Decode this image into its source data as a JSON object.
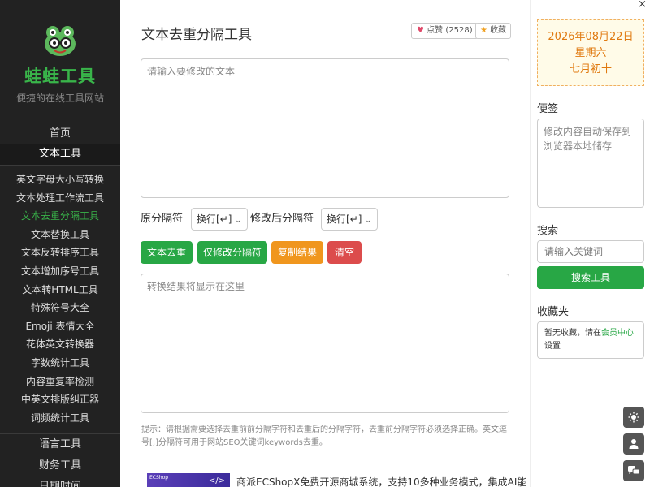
{
  "sidebar": {
    "title": "蛙蛙工具",
    "subtitle": "便捷的在线工具网站",
    "home": "首页",
    "active_category": "文本工具",
    "sub_items": [
      "英文字母大小写转换",
      "文本处理工作流工具",
      "文本去重分隔工具",
      "文本替换工具",
      "文本反转排序工具",
      "文本增加序号工具",
      "文本转HTML工具",
      "特殊符号大全",
      "Emoji 表情大全",
      "花体英文转换器",
      "字数统计工具",
      "内容重复率检测",
      "中英文排版纠正器",
      "词频统计工具"
    ],
    "active_sub_index": 2,
    "categories": [
      "语言工具",
      "财务工具",
      "日期时间"
    ]
  },
  "main": {
    "title": "文本去重分隔工具",
    "like_label": "点赞",
    "like_count": "(2528)",
    "fav_label": "收藏",
    "input_placeholder": "请输入要修改的文本",
    "sep_original_label": "原分隔符",
    "sep_original_value": "换行[↵]",
    "sep_new_label": "修改后分隔符",
    "sep_new_value": "换行[↵]",
    "buttons": {
      "dedup": "文本去重",
      "modify_sep": "仅修改分隔符",
      "copy": "复制结果",
      "clear": "清空"
    },
    "output_placeholder": "转换结果将显示在这里",
    "hint": "提示：请根据需要选择去重前前分隔字符和去重后的分隔字符，去重前分隔字符必须选择正确。英文逗号[,]分隔符可用于网站SEO关键词keywords去重。",
    "ad_image_text": "ECShop",
    "ad_image_code": "</>",
    "ad_text": "商派ECShopX免费开源商城系统，支持10多种业务模式，集成AI能"
  },
  "right": {
    "date": "2026年08月22日",
    "weekday": "星期六",
    "lunar": "七月初十",
    "note_title": "便签",
    "note_placeholder": "修改内容自动保存到浏览器本地储存",
    "search_title": "搜索",
    "search_placeholder": "请输入关键词",
    "search_button": "搜索工具",
    "fav_title": "收藏夹",
    "fav_text_before": "暂无收藏，请在",
    "fav_link": "会员中心",
    "fav_text_after": "设置",
    "close": "×"
  }
}
